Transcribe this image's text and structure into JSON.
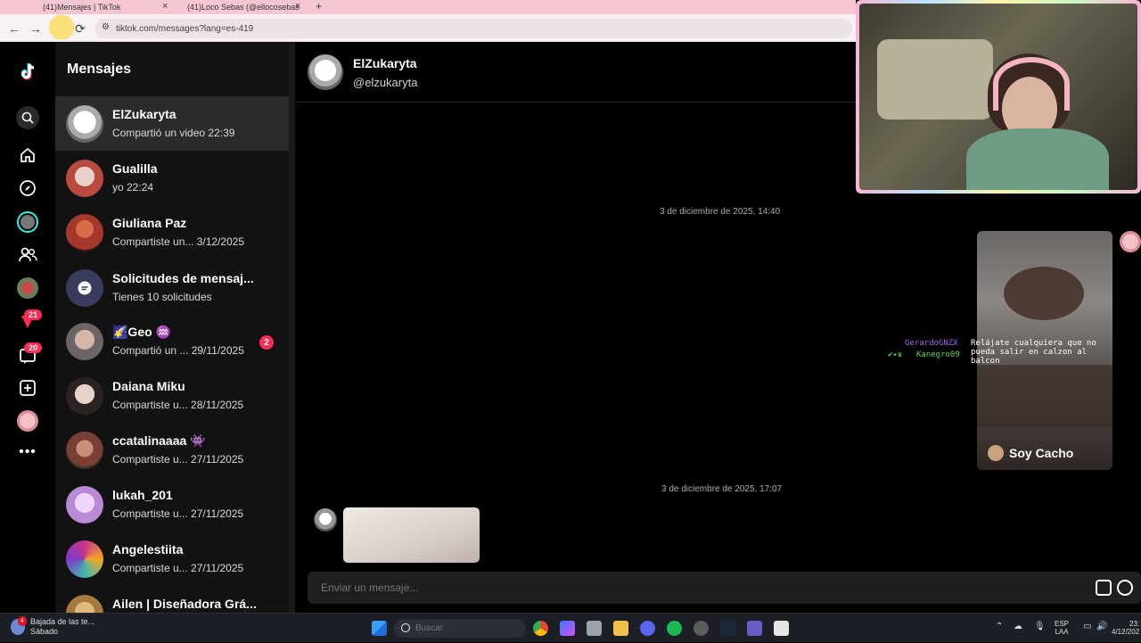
{
  "browser": {
    "tabs": [
      {
        "label": "(41)Mensajes | TikTok",
        "close": "×"
      },
      {
        "label": "(41)Loco Sebas (@ellocosebas",
        "close": "×"
      }
    ],
    "new_tab": "+",
    "url": "tiktok.com/messages?lang=es-419"
  },
  "rail": {
    "badges": {
      "activity": "21",
      "inbox": "20"
    }
  },
  "conversations": {
    "title": "Mensajes",
    "items": [
      {
        "name": "ElZukaryta",
        "sub": "Compartió un video 22:39",
        "selected": true,
        "avatar_color": "#d9d9d9"
      },
      {
        "name": "Gualilla",
        "sub": "yo 22:24",
        "avatar_color": "#b94a3f"
      },
      {
        "name": "Giuliana Paz",
        "sub": "Compartiste un... 3/12/2025",
        "avatar_color": "#a5372b"
      },
      {
        "name": "Solicitudes de mensaj...",
        "sub": "Tienes 10 solicitudes",
        "avatar_color": "#3a3c5e"
      },
      {
        "name": "🌠Geo ♒",
        "sub": "Compartió un ... 29/11/2025",
        "badge": "2",
        "avatar_color": "#6d6565"
      },
      {
        "name": "Daiana Miku",
        "sub": "Compartiste u... 28/11/2025",
        "avatar_color": "#5a5252"
      },
      {
        "name": "ccatalinaaaa 👾",
        "sub": "Compartiste u... 27/11/2025",
        "avatar_color": "#7a3f34"
      },
      {
        "name": "lukah_201",
        "sub": "Compartiste u... 27/11/2025",
        "avatar_color": "#b98ad6"
      },
      {
        "name": "Angelestiita",
        "sub": "Compartiste u... 27/11/2025",
        "avatar_color": "#c9338c"
      },
      {
        "name": "Ailen | Diseñadora Grá...",
        "sub": "",
        "avatar_color": "#a67a3e"
      }
    ]
  },
  "chat": {
    "name": "ElZukaryta",
    "handle": "@elzukaryta",
    "dates": [
      "3 de diciembre de 2025, 14:40",
      "3 de diciembre de 2025, 17:07"
    ],
    "video_author": "Soy Cacho",
    "composer_placeholder": "Enviar un mensaje..."
  },
  "stream_chat": {
    "user1": "GerardoGNZX",
    "msg1": "Relájate cualquiera que no pueda salir en calzon al balcon",
    "user2": "Kanegro09"
  },
  "taskbar": {
    "weather_title": "Bajada de las te...",
    "weather_sub": "Sábado",
    "weather_badge": "4",
    "search_placeholder": "Buscar",
    "lang_1": "ESP",
    "lang_2": "LAA",
    "time": "23:",
    "date": "4/12/202"
  }
}
